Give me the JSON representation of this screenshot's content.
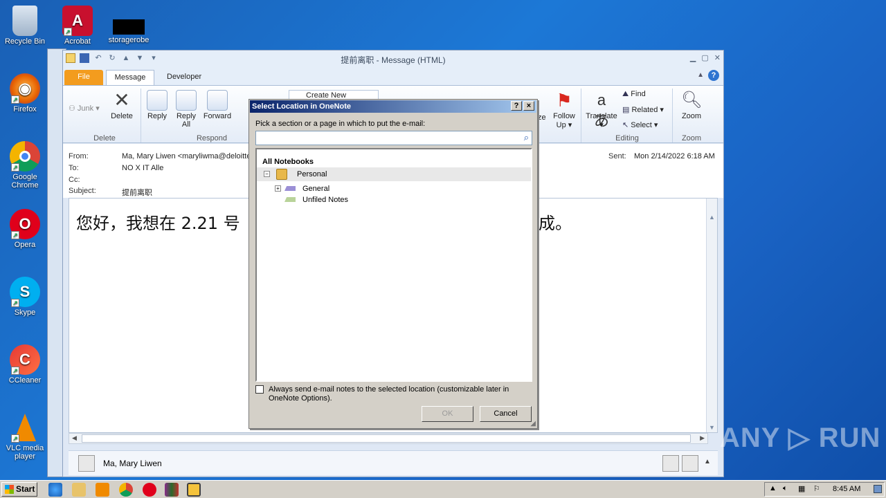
{
  "desktop": {
    "icons": [
      {
        "label": "Recycle Bin",
        "icon": "recycle-bin-icon"
      },
      {
        "label": "Acrobat",
        "icon": "acrobat-icon"
      },
      {
        "label": "storagerobe",
        "icon": "file-icon"
      },
      {
        "label": "Firefox",
        "icon": "firefox-icon"
      },
      {
        "label": "Google Chrome",
        "icon": "chrome-icon"
      },
      {
        "label": "Opera",
        "icon": "opera-icon"
      },
      {
        "label": "Skype",
        "icon": "skype-icon"
      },
      {
        "label": "CCleaner",
        "icon": "ccleaner-icon"
      },
      {
        "label": "VLC media player",
        "icon": "vlc-icon"
      }
    ]
  },
  "window": {
    "title": "提前离职 - Message (HTML)",
    "tabs": {
      "file": "File",
      "message": "Message",
      "developer": "Developer"
    },
    "ribbon": {
      "junk": "Junk",
      "delete": "Delete",
      "reply": "Reply",
      "reply_all_1": "Reply",
      "reply_all_2": "All",
      "forward": "Forward",
      "create_new": "Create New",
      "follow_up_1": "Follow",
      "follow_up_2": "Up",
      "ze": "ze",
      "translate": "Translate",
      "find": "Find",
      "related": "Related",
      "select": "Select",
      "zoom": "Zoom",
      "groups": {
        "delete": "Delete",
        "respond": "Respond",
        "editing": "Editing",
        "zoom": "Zoom"
      }
    },
    "header": {
      "from_label": "From:",
      "from_value": "Ma, Mary Liwen <maryliwma@deloitte",
      "to_label": "To:",
      "to_value": "NO X IT Alle",
      "cc_label": "Cc:",
      "subject_label": "Subject:",
      "subject_value": "提前离职",
      "sent_label": "Sent:",
      "sent_value": "Mon 2/14/2022 6:18 AM"
    },
    "body_text_left": "您好，我想在 2.21 号",
    "body_text_right": "成。",
    "people_pane_name": "Ma, Mary Liwen"
  },
  "dialog": {
    "title": "Select Location in OneNote",
    "help": "?",
    "close": "×",
    "instruction": "Pick a section or a page in which to put the e-mail:",
    "search_value": "",
    "tree": {
      "root": "All Notebooks",
      "notebook": "Personal",
      "section": "General",
      "unfiled": "Unfiled Notes"
    },
    "checkbox_label_1": "Always send e-mail notes to the selected location (customizable later in",
    "checkbox_label_2": "OneNote Options).",
    "ok": "OK",
    "cancel": "Cancel"
  },
  "taskbar": {
    "start": "Start",
    "time": "8:45 AM"
  },
  "watermark": "ANY ▷ RUN",
  "colors": {
    "file_tab": "#f39c1e",
    "dialog_title": "#0a246a",
    "desktop": "#1c78d6"
  }
}
